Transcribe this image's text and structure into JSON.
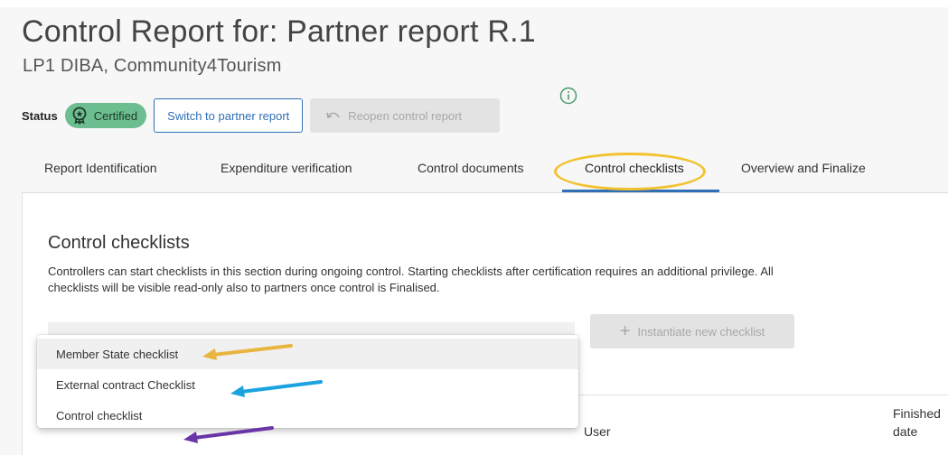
{
  "header": {
    "title": "Control Report for: Partner report R.1",
    "subtitle": "LP1 DIBA, Community4Tourism"
  },
  "status": {
    "label": "Status",
    "badge": "Certified",
    "badge_color": "#6cbd8f",
    "switch_button": "Switch to partner report",
    "reopen_button": "Reopen control report",
    "info_icon": "info-icon"
  },
  "tabs": [
    {
      "label": "Report Identification"
    },
    {
      "label": "Expenditure verification"
    },
    {
      "label": "Control documents"
    },
    {
      "label": "Control checklists",
      "active": true
    },
    {
      "label": "Overview and Finalize"
    }
  ],
  "section": {
    "title": "Control checklists",
    "description": "Controllers can start checklists in this section during ongoing control. Starting checklists after certification requires an additional privilege. All checklists will be visible read-only also to partners once control is Finalised."
  },
  "instantiate_button": "Instantiate new checklist",
  "dropdown": {
    "options": [
      {
        "label": "Member State checklist",
        "arrow_color": "#e8b53f"
      },
      {
        "label": "External contract Checklist",
        "arrow_color": "#1aa3e0"
      },
      {
        "label": "Control checklist",
        "arrow_color": "#6a35a8"
      }
    ]
  },
  "table": {
    "columns": [
      "User",
      "Finished date"
    ]
  },
  "accent_color": "#2f6fb5",
  "highlight_color": "#f2c230"
}
